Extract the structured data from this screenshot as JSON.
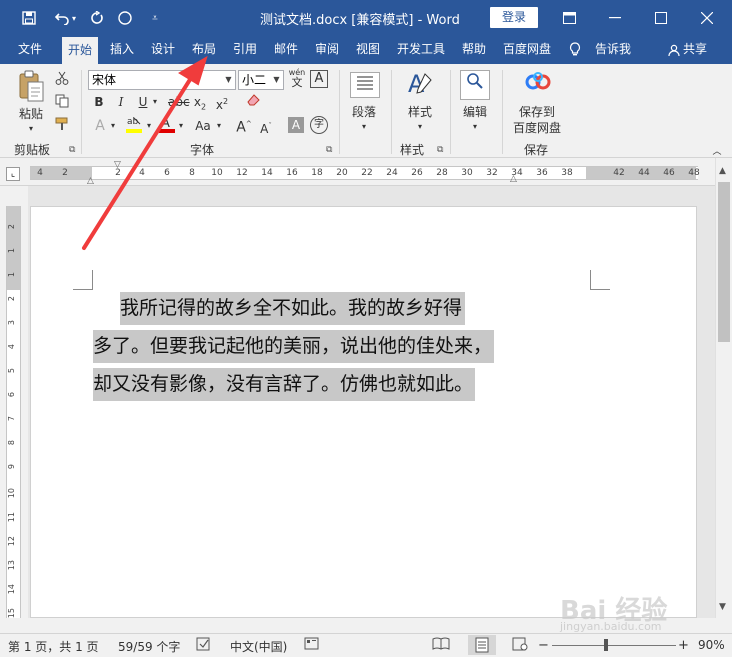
{
  "window": {
    "title": "测试文档.docx [兼容模式] - Word",
    "login_label": "登录"
  },
  "tabs": [
    "文件",
    "开始",
    "插入",
    "设计",
    "布局",
    "引用",
    "邮件",
    "审阅",
    "视图",
    "开发工具",
    "帮助",
    "百度网盘"
  ],
  "active_tab": "开始",
  "tell_me": "告诉我",
  "share": "共享",
  "ribbon": {
    "clipboard": {
      "label": "剪贴板",
      "paste": "粘贴"
    },
    "font": {
      "label": "字体",
      "family": "宋体",
      "size": "小二",
      "wen_top": "wén",
      "wen_bottom": "文"
    },
    "paragraph": {
      "label": "段落"
    },
    "styles": {
      "label": "样式",
      "button": "样式"
    },
    "editing": {
      "label": "编辑"
    },
    "save": {
      "label": "保存",
      "button_line1": "保存到",
      "button_line2": "百度网盘"
    }
  },
  "ruler_numbers": [
    "4",
    "2",
    "2",
    "4",
    "6",
    "8",
    "10",
    "12",
    "14",
    "16",
    "18",
    "20",
    "22",
    "24",
    "26",
    "28",
    "30",
    "32",
    "34",
    "36",
    "38",
    "42",
    "44",
    "46",
    "48"
  ],
  "vruler_numbers": [
    "2",
    "1",
    "1",
    "2",
    "3",
    "4",
    "5",
    "6",
    "7",
    "8",
    "9",
    "10",
    "11",
    "12",
    "13",
    "14",
    "15"
  ],
  "document": {
    "lines": [
      "我所记得的故乡全不如此。我的故乡好得",
      "多了。但要我记起他的美丽，说出他的佳处来，",
      "却又没有影像，没有言辞了。仿佛也就如此。"
    ]
  },
  "status": {
    "page": "第 1 页，共 1 页",
    "words": "59/59 个字",
    "language": "中文(中国)",
    "zoom": "90%"
  },
  "watermark": {
    "main": "Bai 经验",
    "sub": "jingyan.baidu.com"
  }
}
